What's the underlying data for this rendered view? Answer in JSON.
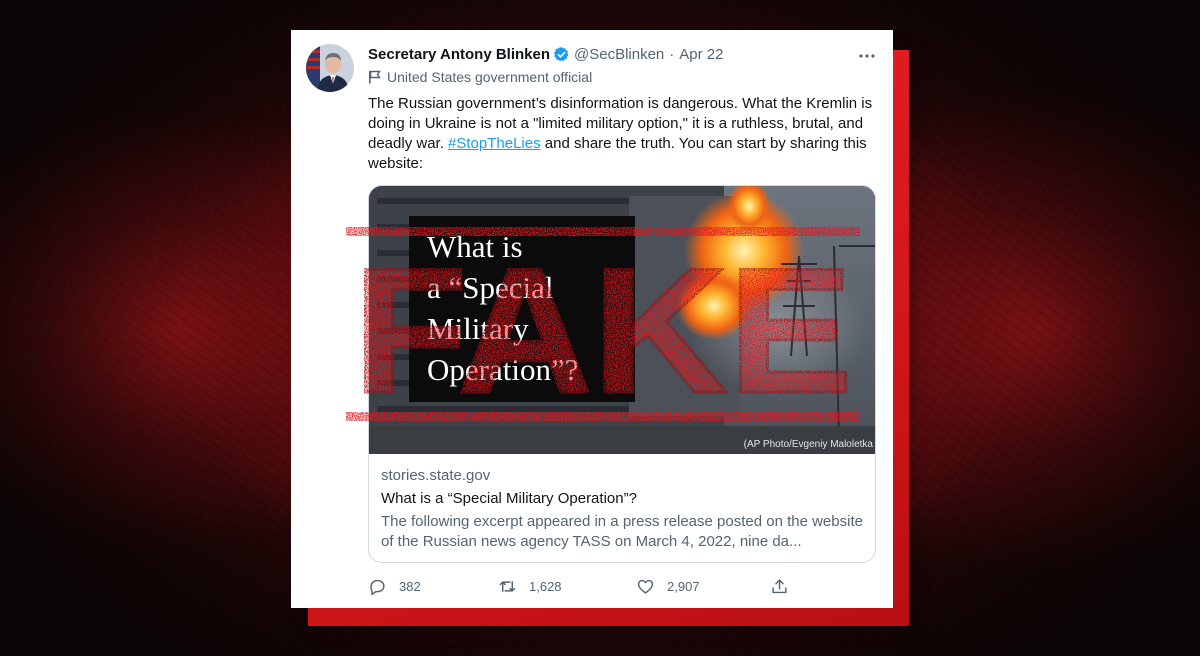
{
  "tweet": {
    "display_name": "Secretary Antony Blinken",
    "handle": "@SecBlinken",
    "separator": "·",
    "date": "Apr 22",
    "affiliation": "United States government official",
    "text_part1": "The Russian government’s disinformation is dangerous. What the Kremlin is doing in Ukraine is not a \"limited military option,\" it is a ruthless, brutal, and deadly war. ",
    "hashtag": "#StopTheLies",
    "text_part2": " and share the truth. You can start by sharing this website:"
  },
  "link_card": {
    "image_text": [
      "What is",
      "a “Special",
      "Military",
      "Operation”?"
    ],
    "image_credit": "(AP Photo/Evgeniy Maloletka",
    "domain": "stories.state.gov",
    "title": "What is a “Special Military Operation”?",
    "description": "The following excerpt appeared in a press release posted on the website of the Russian news agency TASS on March 4, 2022, nine da..."
  },
  "actions": {
    "replies": "382",
    "retweets": "1,628",
    "likes": "2,907"
  },
  "stamp": {
    "text": "FAKE",
    "color": "#e2161c"
  },
  "colors": {
    "verified": "#1d9bf0",
    "link": "#1d9bf0",
    "backplate": "#e92024"
  },
  "icons": [
    "verified-badge-icon",
    "more-icon",
    "government-flag-icon",
    "reply-icon",
    "retweet-icon",
    "like-icon",
    "share-icon"
  ]
}
